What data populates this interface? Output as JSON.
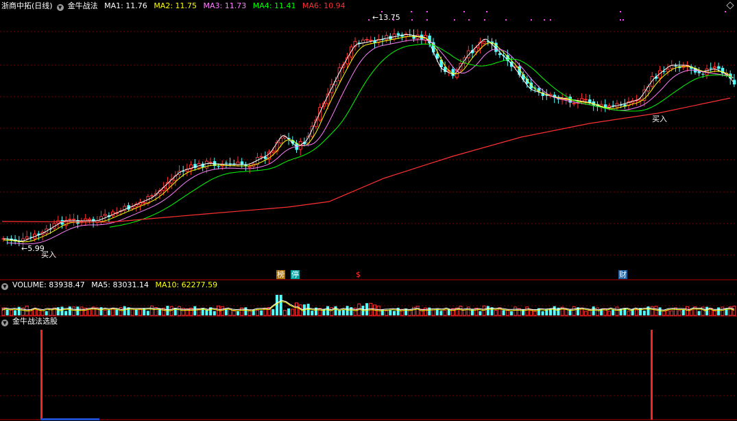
{
  "main_header": {
    "symbol": "浙商中拓(日线)",
    "indicator": "金牛战法",
    "ma_items": [
      {
        "label": "MA1: 11.76",
        "color": "#ffffff"
      },
      {
        "label": "MA2: 11.75",
        "color": "#ffff00"
      },
      {
        "label": "MA3: 11.73",
        "color": "#ff80ff"
      },
      {
        "label": "MA4: 11.41",
        "color": "#00ff00"
      },
      {
        "label": "MA6: 10.94",
        "color": "#ff3030"
      }
    ]
  },
  "volume_header": {
    "title": "VOLUME: 83938.47",
    "ma5": "MA5: 83031.14",
    "ma10": "MA10: 62277.59"
  },
  "signal_header": {
    "title": "金牛战法选股"
  },
  "annotations": {
    "high": "13.75",
    "low": "5.99",
    "buy1": "买入",
    "buy2": "买入"
  },
  "badges": [
    {
      "text": "榜",
      "bg": "#b07000",
      "fg": "#ffffff"
    },
    {
      "text": "停",
      "bg": "#00a0a0",
      "fg": "#ffffff"
    },
    {
      "text": "$",
      "bg": "#000000",
      "fg": "#ff3030"
    },
    {
      "text": "财",
      "bg": "#1e5fa0",
      "fg": "#ffffff"
    }
  ],
  "colors": {
    "up": "#ff3232",
    "down": "#54ffff",
    "grid": "#7a0000",
    "divider": "#b00000",
    "ma1": "#ffffff",
    "ma2": "#ffff00",
    "ma3": "#ff80ff",
    "ma4": "#00ff00",
    "ma6": "#ff3030"
  }
}
